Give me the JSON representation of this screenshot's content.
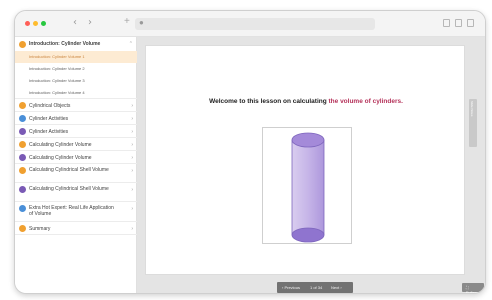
{
  "window": {
    "controls": {
      "close_color": "#ff5f57",
      "minimize_color": "#febc2e",
      "zoom_color": "#28c840"
    },
    "nav": {
      "back": "‹",
      "forward": "›"
    },
    "new_tab": "+",
    "url_icon": "lock-icon"
  },
  "sidebar": {
    "section1": {
      "label": "Introduction: Cylinder Volume",
      "chevron": "⌃",
      "color": "#f0a030"
    },
    "subitems": [
      {
        "label": "Introduction: Cylinder Volume 1"
      },
      {
        "label": "Introduction: Cylinder Volume 2"
      },
      {
        "label": "Introduction: Cylinder Volume 3"
      },
      {
        "label": "Introduction: Cylinder Volume 4"
      }
    ],
    "sections": [
      {
        "label": "Cylindrical Objects",
        "color": "#f0a030"
      },
      {
        "label": "Cylinder Activities",
        "color": "#4a8fd8"
      },
      {
        "label": "Cylinder Activities",
        "color": "#7a5ab5"
      },
      {
        "label": "Calculating Cylinder Volume",
        "color": "#f0a030"
      },
      {
        "label": "Calculating Cylinder Volume",
        "color": "#7a5ab5"
      },
      {
        "label": "Calculating Cylindrical Shell Volume",
        "color": "#f0a030"
      },
      {
        "label": "Calculating Cylindrical Shell Volume",
        "color": "#7a5ab5"
      },
      {
        "label": "Extra Hot Expert: Real Life Application of Volume",
        "color": "#4a8fd8"
      },
      {
        "label": "Summary",
        "color": "#f0a030"
      }
    ]
  },
  "slide": {
    "heading_main": "Welcome to this lesson on calculating",
    "heading_highlight": "the volume of cylinders.",
    "highlight_color": "#b5325a"
  },
  "side_tab": "Slide Notes",
  "pager": {
    "prev": "‹ Previous",
    "count": "1 of 34",
    "next": "Next ›"
  },
  "fullscreen": "⛶ Fullscreen"
}
